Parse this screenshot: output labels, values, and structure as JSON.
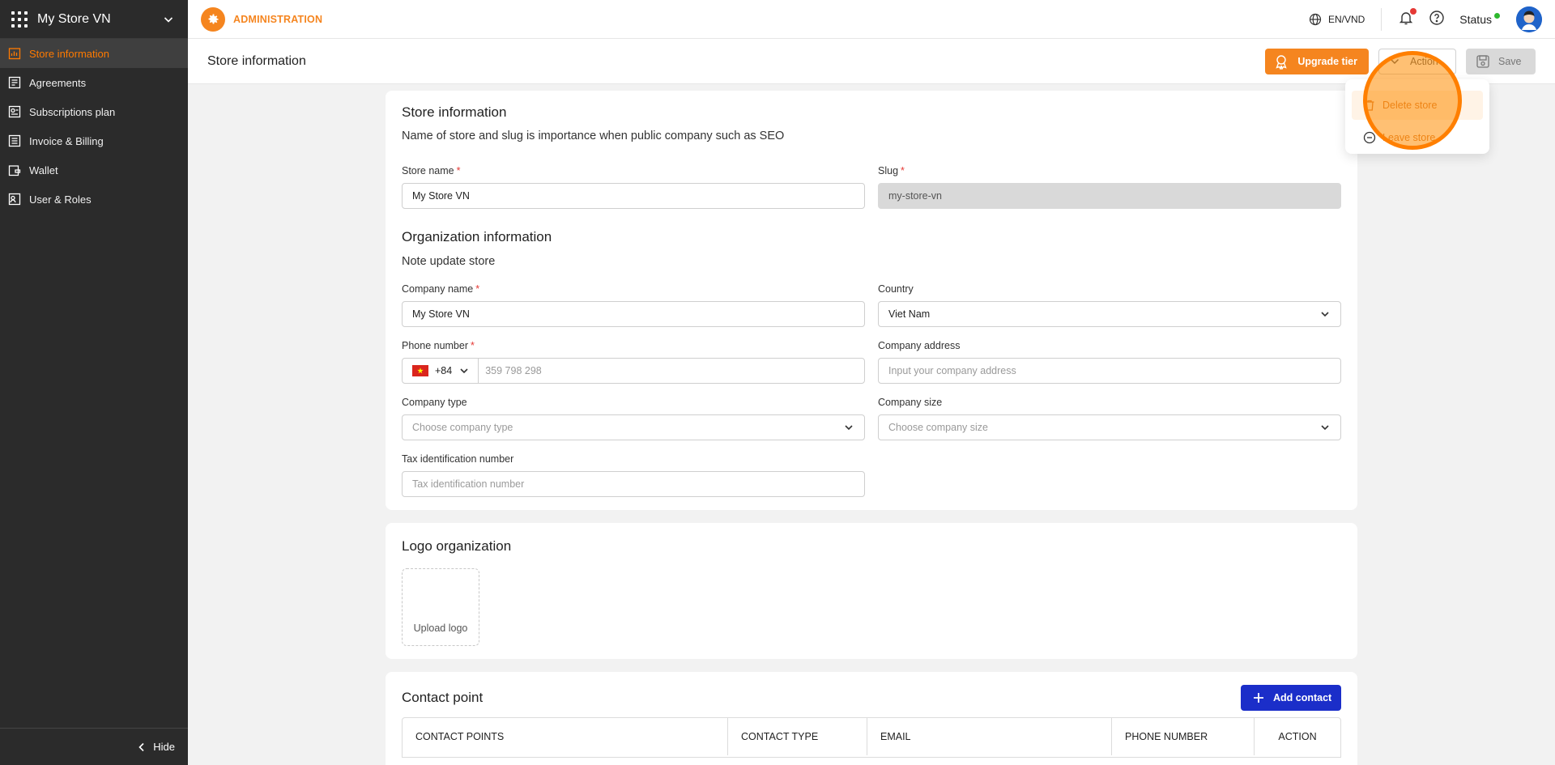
{
  "sidebar": {
    "store_name": "My Store VN",
    "items": [
      {
        "label": "Store information",
        "icon": "store-chart-icon",
        "active": true
      },
      {
        "label": "Agreements",
        "icon": "document-icon"
      },
      {
        "label": "Subscriptions plan",
        "icon": "subscription-icon"
      },
      {
        "label": "Invoice & Billing",
        "icon": "invoice-icon"
      },
      {
        "label": "Wallet",
        "icon": "wallet-icon"
      },
      {
        "label": "User & Roles",
        "icon": "users-icon"
      }
    ],
    "hide_label": "Hide"
  },
  "topbar": {
    "section_label": "ADMINISTRATION",
    "language": "EN/VND",
    "status_label": "Status"
  },
  "page": {
    "title": "Store information",
    "upgrade_label": "Upgrade tier",
    "action_label": "Action",
    "save_label": "Save"
  },
  "action_menu": {
    "delete_label": "Delete store",
    "leave_label": "Leave store"
  },
  "store_info": {
    "title": "Store information",
    "subtitle": "Name of store and slug is importance when public company such as SEO",
    "store_name_label": "Store name",
    "store_name_value": "My Store VN",
    "slug_label": "Slug",
    "slug_value": "my-store-vn"
  },
  "org_info": {
    "title": "Organization information",
    "subtitle": "Note update store",
    "company_name_label": "Company name",
    "company_name_value": "My Store VN",
    "country_label": "Country",
    "country_value": "Viet Nam",
    "phone_label": "Phone number",
    "phone_code": "+84",
    "phone_placeholder": "359 798 298",
    "address_label": "Company address",
    "address_placeholder": "Input your company address",
    "type_label": "Company type",
    "type_placeholder": "Choose company type",
    "size_label": "Company size",
    "size_placeholder": "Choose company size",
    "tax_label": "Tax identification number",
    "tax_placeholder": "Tax identification number"
  },
  "logo": {
    "title": "Logo organization",
    "upload_label": "Upload logo"
  },
  "contact": {
    "title": "Contact point",
    "add_label": "Add contact",
    "columns": [
      "CONTACT POINTS",
      "CONTACT TYPE",
      "EMAIL",
      "PHONE NUMBER",
      "ACTION"
    ]
  },
  "colors": {
    "accent": "#f5851f",
    "primary_blue": "#1b2ec9",
    "sidebar_bg": "#2b2b2b"
  }
}
